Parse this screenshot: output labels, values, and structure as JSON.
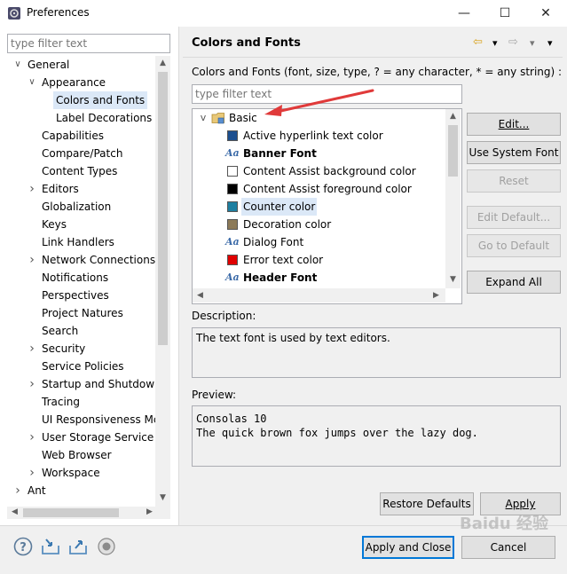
{
  "window": {
    "title": "Preferences",
    "controls": {
      "minimize": "—",
      "maximize": "☐",
      "close": "✕"
    }
  },
  "left": {
    "filter_placeholder": "type filter text",
    "tree": [
      {
        "label": "General",
        "indent": 0,
        "twisty": "v"
      },
      {
        "label": "Appearance",
        "indent": 1,
        "twisty": "v"
      },
      {
        "label": "Colors and Fonts",
        "indent": 2,
        "twisty": "",
        "selected": true
      },
      {
        "label": "Label Decorations",
        "indent": 2,
        "twisty": ""
      },
      {
        "label": "Capabilities",
        "indent": 1,
        "twisty": ""
      },
      {
        "label": "Compare/Patch",
        "indent": 1,
        "twisty": ""
      },
      {
        "label": "Content Types",
        "indent": 1,
        "twisty": ""
      },
      {
        "label": "Editors",
        "indent": 1,
        "twisty": ">"
      },
      {
        "label": "Globalization",
        "indent": 1,
        "twisty": ""
      },
      {
        "label": "Keys",
        "indent": 1,
        "twisty": ""
      },
      {
        "label": "Link Handlers",
        "indent": 1,
        "twisty": ""
      },
      {
        "label": "Network Connections",
        "indent": 1,
        "twisty": ">"
      },
      {
        "label": "Notifications",
        "indent": 1,
        "twisty": ""
      },
      {
        "label": "Perspectives",
        "indent": 1,
        "twisty": ""
      },
      {
        "label": "Project Natures",
        "indent": 1,
        "twisty": ""
      },
      {
        "label": "Search",
        "indent": 1,
        "twisty": ""
      },
      {
        "label": "Security",
        "indent": 1,
        "twisty": ">"
      },
      {
        "label": "Service Policies",
        "indent": 1,
        "twisty": ""
      },
      {
        "label": "Startup and Shutdown",
        "indent": 1,
        "twisty": ">"
      },
      {
        "label": "Tracing",
        "indent": 1,
        "twisty": ""
      },
      {
        "label": "UI Responsiveness Mc",
        "indent": 1,
        "twisty": ""
      },
      {
        "label": "User Storage Service",
        "indent": 1,
        "twisty": ">"
      },
      {
        "label": "Web Browser",
        "indent": 1,
        "twisty": ""
      },
      {
        "label": "Workspace",
        "indent": 1,
        "twisty": ">"
      },
      {
        "label": "Ant",
        "indent": 0,
        "twisty": ">"
      }
    ]
  },
  "right": {
    "title": "Colors and Fonts",
    "nav": {
      "back": "⇦",
      "forward": "⇨",
      "dropdown": "▾",
      "menu": "▾"
    },
    "instructions": "Colors and Fonts (font, size, type, ? = any character, * = any string) :",
    "filter_placeholder": "type filter text",
    "category": {
      "label": "Basic",
      "twisty": "v"
    },
    "items": [
      {
        "label": "Active hyperlink text color",
        "kind": "color",
        "color": "#1c4f8f"
      },
      {
        "label": "Banner Font",
        "kind": "font",
        "bold": true
      },
      {
        "label": "Content Assist background color",
        "kind": "color",
        "color": "#ffffff"
      },
      {
        "label": "Content Assist foreground color",
        "kind": "color",
        "color": "#000000"
      },
      {
        "label": "Counter color",
        "kind": "color",
        "color": "#1e7fa0",
        "highlight": true
      },
      {
        "label": "Decoration color",
        "kind": "color",
        "color": "#8c7a58"
      },
      {
        "label": "Dialog Font",
        "kind": "font",
        "bold": false
      },
      {
        "label": "Error text color",
        "kind": "color",
        "color": "#e00000"
      },
      {
        "label": "Header Font",
        "kind": "font",
        "bold": true
      }
    ],
    "font_icon_glyph": "Aa",
    "buttons": {
      "edit": "Edit...",
      "use_system_font": "Use System Font",
      "reset": "Reset",
      "edit_default": "Edit Default...",
      "go_to_default": "Go to Default",
      "expand_all": "Expand All"
    },
    "description_label": "Description:",
    "description_text": "The text font is used by text editors.",
    "preview_label": "Preview:",
    "preview_lines": [
      "Consolas 10",
      "The quick brown fox jumps over the lazy dog."
    ],
    "restore_defaults": "Restore Defaults",
    "apply": "Apply"
  },
  "bottom": {
    "apply_and_close": "Apply and Close",
    "cancel": "Cancel",
    "icons": [
      "help-icon",
      "import-icon",
      "export-icon",
      "record-icon"
    ]
  },
  "watermark": "Baidu 经验",
  "colors": {
    "selection": "#dbe8f7",
    "accent": "#0078d7",
    "annotation": "#e03a3a"
  }
}
